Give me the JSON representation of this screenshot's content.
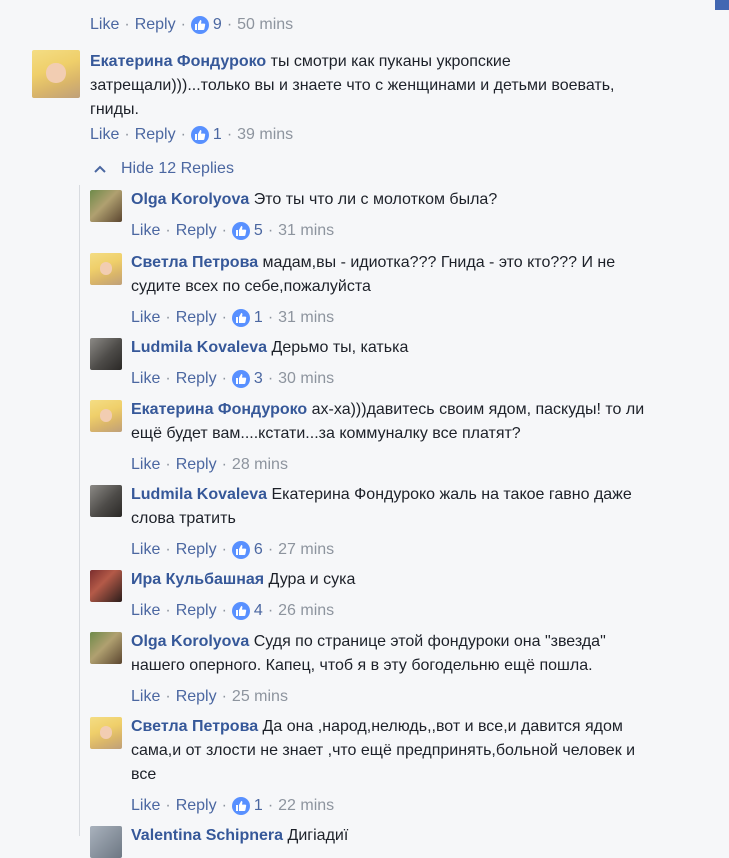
{
  "actions": {
    "like": "Like",
    "reply": "Reply"
  },
  "top_actions": {
    "likes": "9",
    "time": "50 mins"
  },
  "main_comment": {
    "author": "Екатерина Фондуроко",
    "text_line1": "ты смотри как пуканы укропские",
    "text_line2": "затрещали)))...только вы и знаете что с женщинами и детьми воевать,",
    "text_line3": "гниды.",
    "likes": "1",
    "time": "39 mins"
  },
  "hide_replies_label": "Hide 12 Replies",
  "replies": [
    {
      "author": "Olga Korolyova",
      "lines": [
        "Это ты что ли с молотком была?"
      ],
      "likes": "5",
      "time": "31 mins"
    },
    {
      "author": "Светла Петрова",
      "lines": [
        "мадам,вы - идиотка??? Гнида - это кто??? И не",
        "судите всех по себе,пожалуйста"
      ],
      "likes": "1",
      "time": "31 mins"
    },
    {
      "author": "Ludmila Kovaleva",
      "lines": [
        "Дерьмо ты, катька"
      ],
      "likes": "3",
      "time": "30 mins"
    },
    {
      "author": "Екатерина Фондуроко",
      "lines": [
        "ах-ха)))давитесь своим ядом, паскуды! то ли",
        "ещё будет вам....кстати...за коммуналку все платят?"
      ],
      "likes": "",
      "time": "28 mins"
    },
    {
      "author": "Ludmila Kovaleva",
      "lines": [
        "Екатерина Фондуроко жаль на такое гавно даже",
        "слова тратить"
      ],
      "likes": "6",
      "time": "27 mins"
    },
    {
      "author": "Ира Кульбашная",
      "lines": [
        "Дура и сука"
      ],
      "likes": "4",
      "time": "26 mins"
    },
    {
      "author": "Olga Korolyova",
      "lines": [
        "Судя по странице этой фондуроки она \"звезда\"",
        "нашего оперного. Капец, чтоб я в эту богодельню ещё пошла."
      ],
      "likes": "",
      "time": "25 mins"
    },
    {
      "author": "Светла Петрова",
      "lines": [
        "Да она ,народ,нелюдь,,вот и все,и давится ядом",
        "сама,и от злости не знает ,что ещё предпринять,больной человек и",
        "все"
      ],
      "likes": "1",
      "time": "22 mins"
    },
    {
      "author": "Valentina Schipnera",
      "lines": [
        "Дигіадиї"
      ],
      "likes": "",
      "time": ""
    }
  ],
  "colors": {
    "author": "#365899",
    "link": "#4b67a1",
    "meta": "#8d949e",
    "like_badge": "#5890ff",
    "background": "#f6f7f9"
  }
}
